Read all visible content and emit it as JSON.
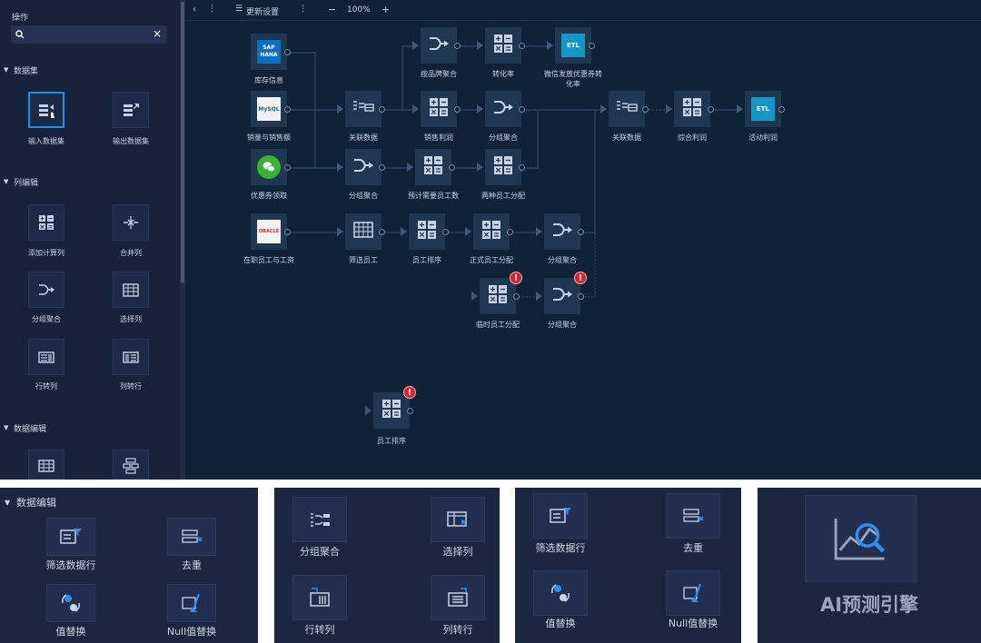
{
  "sidebar": {
    "header": "操作",
    "search": {
      "value": "",
      "clear_icon": "×"
    },
    "sections": [
      {
        "title": "数据集",
        "items": [
          {
            "label": "输入数据集"
          },
          {
            "label": "输出数据集"
          }
        ]
      },
      {
        "title": "列编辑",
        "items": [
          {
            "label": "添加计算列"
          },
          {
            "label": "合并列"
          },
          {
            "label": "分组聚合"
          },
          {
            "label": "选择列"
          },
          {
            "label": "行转列"
          },
          {
            "label": "列转行"
          }
        ]
      },
      {
        "title": "数据编辑"
      }
    ]
  },
  "toolbar": {
    "update_label": "更新设置",
    "zoom": "100%",
    "minus": "−",
    "plus": "+"
  },
  "nodes": {
    "n_sap": {
      "label": "库存信息",
      "logo": "SAP HANA"
    },
    "n_mysql": {
      "label": "销量与销售额",
      "logo": "MySQL"
    },
    "n_wechat": {
      "label": "优惠券领取"
    },
    "n_oracle": {
      "label": "在职员工与工资",
      "logo": "ORACLE"
    },
    "n_join1": {
      "label": "关联数据"
    },
    "n_group1": {
      "label": "分组聚合"
    },
    "n_filter": {
      "label": "筛选员工"
    },
    "n_brand": {
      "label": "按品牌聚合"
    },
    "n_profit": {
      "label": "销售利润"
    },
    "n_est": {
      "label": "预计需要员工数"
    },
    "n_sort": {
      "label": "员工排序"
    },
    "n_conv": {
      "label": "转化率"
    },
    "n_group2": {
      "label": "分组聚合"
    },
    "n_two": {
      "label": "两种员工分配"
    },
    "n_formal": {
      "label": "正式员工分配"
    },
    "n_temp": {
      "label": "临时员工分配"
    },
    "n_etl1": {
      "label": "微信发放优惠券转化率",
      "logo": "ETL"
    },
    "n_group3": {
      "label": "分组聚合"
    },
    "n_group4": {
      "label": "分组聚合"
    },
    "n_join2": {
      "label": "关联数据"
    },
    "n_total": {
      "label": "综合利润"
    },
    "n_etl2": {
      "label": "活动利润",
      "logo": "ETL"
    },
    "n_sort2": {
      "label": "员工排序"
    }
  },
  "error_mark": "!",
  "panels": {
    "p1": {
      "title": "数据编辑",
      "items": [
        {
          "label": "筛选数据行"
        },
        {
          "label": "去重"
        },
        {
          "label": "值替换"
        },
        {
          "label": "Null值替换"
        }
      ]
    },
    "p2": {
      "items": [
        {
          "label": "分组聚合"
        },
        {
          "label": "选择列"
        },
        {
          "label": "行转列"
        },
        {
          "label": "列转行"
        }
      ]
    },
    "p3": {
      "items": [
        {
          "label": "筛选数据行"
        },
        {
          "label": "去重"
        },
        {
          "label": "值替换"
        },
        {
          "label": "Null值替换"
        }
      ]
    },
    "p4": {
      "label": "AI预测引擎"
    }
  },
  "colors": {
    "canvas": "#0f2238",
    "sidebar": "#17223b",
    "node": "#203752",
    "accent": "#1f8ef0",
    "error": "#d9232a"
  }
}
